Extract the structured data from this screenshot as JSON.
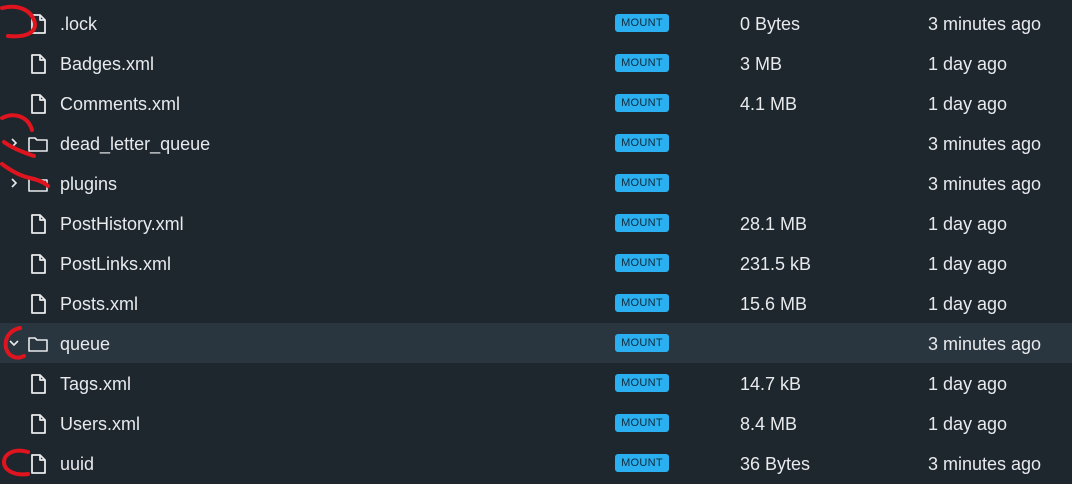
{
  "badge_color": "#2ab0f0",
  "background_color": "#1e272e",
  "selected_row_color": "#2a363f",
  "annotation_color": "#e0141e",
  "files": [
    {
      "name": ".lock",
      "kind": "file",
      "icon": "file-icon",
      "badge": "MOUNT",
      "size": "0 Bytes",
      "modified": "3 minutes ago"
    },
    {
      "name": "Badges.xml",
      "kind": "file",
      "icon": "file-icon",
      "badge": "MOUNT",
      "size": "3 MB",
      "modified": "1 day ago"
    },
    {
      "name": "Comments.xml",
      "kind": "file",
      "icon": "file-icon",
      "badge": "MOUNT",
      "size": "4.1 MB",
      "modified": "1 day ago"
    },
    {
      "name": "dead_letter_queue",
      "kind": "folder",
      "icon": "folder-icon",
      "chevron": "chevron-right-icon",
      "badge": "MOUNT",
      "size": "",
      "modified": "3 minutes ago"
    },
    {
      "name": "plugins",
      "kind": "folder",
      "icon": "folder-icon",
      "chevron": "chevron-right-icon",
      "badge": "MOUNT",
      "size": "",
      "modified": "3 minutes ago"
    },
    {
      "name": "PostHistory.xml",
      "kind": "file",
      "icon": "file-icon",
      "badge": "MOUNT",
      "size": "28.1 MB",
      "modified": "1 day ago"
    },
    {
      "name": "PostLinks.xml",
      "kind": "file",
      "icon": "file-icon",
      "badge": "MOUNT",
      "size": "231.5 kB",
      "modified": "1 day ago"
    },
    {
      "name": "Posts.xml",
      "kind": "file",
      "icon": "file-icon",
      "badge": "MOUNT",
      "size": "15.6 MB",
      "modified": "1 day ago"
    },
    {
      "name": "queue",
      "kind": "folder",
      "icon": "folder-icon",
      "chevron": "chevron-down-icon",
      "badge": "MOUNT",
      "size": "",
      "modified": "3 minutes ago",
      "selected": true
    },
    {
      "name": "Tags.xml",
      "kind": "file",
      "icon": "file-icon",
      "badge": "MOUNT",
      "size": "14.7 kB",
      "modified": "1 day ago"
    },
    {
      "name": "Users.xml",
      "kind": "file",
      "icon": "file-icon",
      "badge": "MOUNT",
      "size": "8.4 MB",
      "modified": "1 day ago"
    },
    {
      "name": "uuid",
      "kind": "file",
      "icon": "file-icon",
      "badge": "MOUNT",
      "size": "36 Bytes",
      "modified": "3 minutes ago"
    }
  ]
}
